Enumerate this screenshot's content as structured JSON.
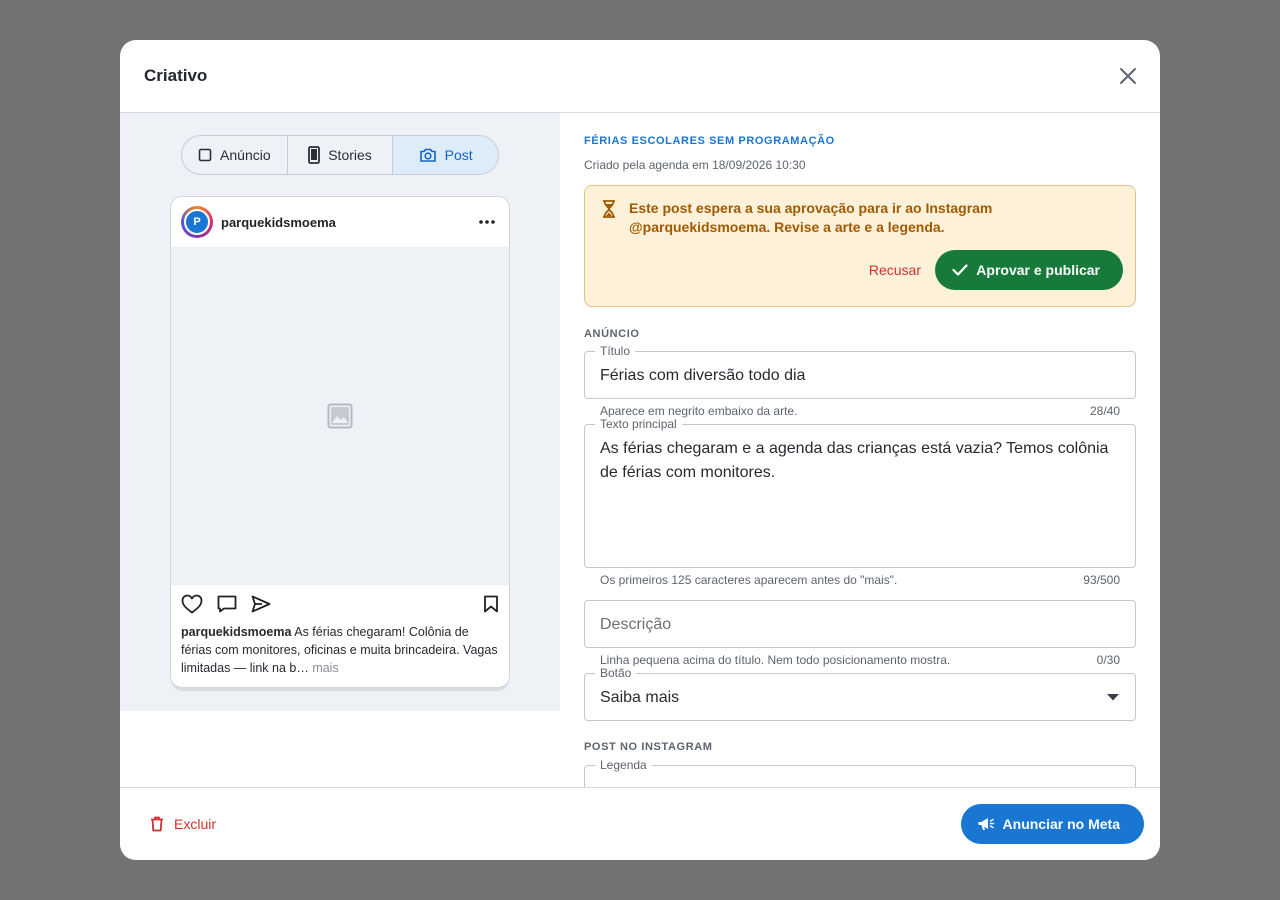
{
  "dialog": {
    "title": "Criativo"
  },
  "preview_tabs": [
    {
      "label": "Anúncio",
      "icon": "square-icon",
      "active": false
    },
    {
      "label": "Stories",
      "icon": "phone-icon",
      "active": false
    },
    {
      "label": "Post",
      "icon": "camera-icon",
      "active": true
    }
  ],
  "instagram_post": {
    "avatar_letter": "P",
    "username": "parquekidsmoema",
    "caption_user": "parquekidsmoema",
    "caption_text": " As férias chegaram! Colônia de férias com monitores, oficinas e muita brincadeira. Vagas limitadas — link na b… ",
    "caption_more": "mais"
  },
  "campaign": {
    "name": "FÉRIAS ESCOLARES SEM PROGRAMAÇÃO",
    "created": "Criado pela agenda em 18/09/2026 10:30"
  },
  "approval": {
    "message": "Este post espera a sua aprovação para ir ao Instagram @parquekidsmoema. Revise a arte e a legenda.",
    "reject_label": "Recusar",
    "approve_label": "Aprovar e publicar"
  },
  "ad_section": {
    "label": "ANÚNCIO",
    "title_field": {
      "label": "Título",
      "value": "Férias com diversão todo dia",
      "helper": "Aparece em negrito embaixo da arte.",
      "count": "28/40"
    },
    "text_field": {
      "label": "Texto principal",
      "value": "As férias chegaram e a agenda das crianças está vazia? Temos colônia de férias com monitores.",
      "helper": "Os primeiros 125 caracteres aparecem antes do \"mais\".",
      "count": "93/500"
    },
    "description_field": {
      "placeholder": "Descrição",
      "helper": "Linha pequena acima do título. Nem todo posicionamento mostra.",
      "count": "0/30"
    },
    "button_field": {
      "label": "Botão",
      "value": "Saiba mais"
    }
  },
  "instagram_section": {
    "label": "POST NO INSTAGRAM",
    "caption_field": {
      "label": "Legenda"
    }
  },
  "footer": {
    "delete_label": "Excluir",
    "publish_label": "Anunciar no Meta"
  },
  "colors": {
    "primary": "#1976d2",
    "approve": "#177a3b",
    "danger": "#d32f2f",
    "warning_bg": "#fdf1d9",
    "warning_text": "#a05a00"
  }
}
